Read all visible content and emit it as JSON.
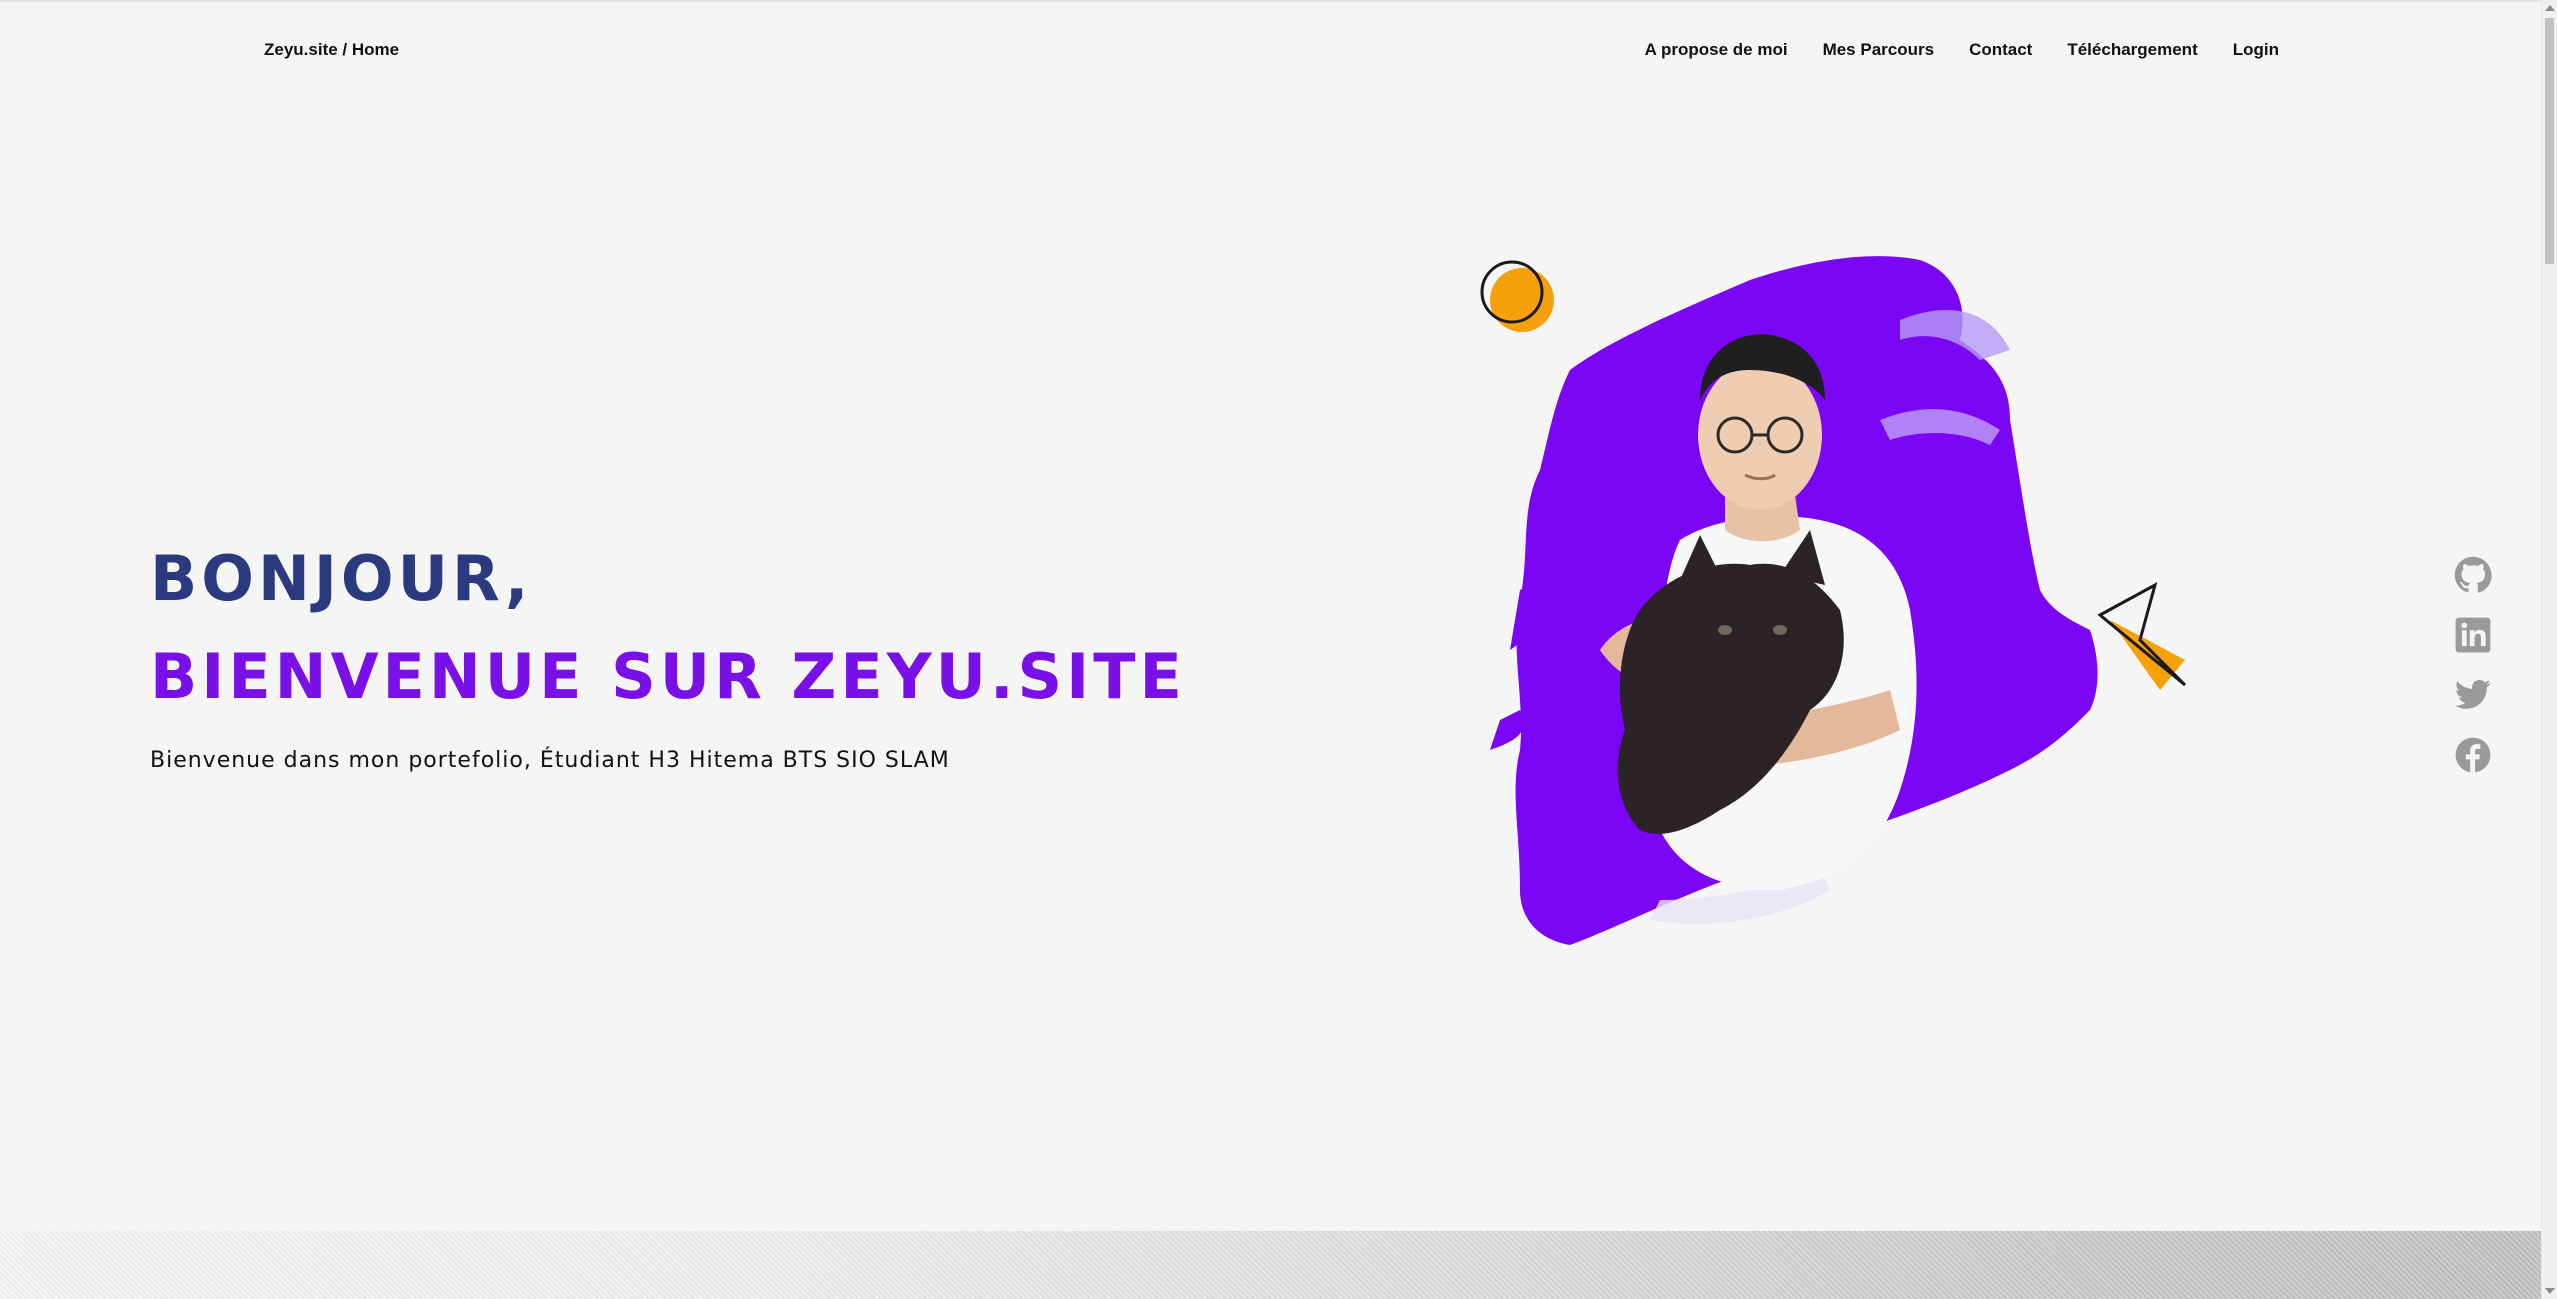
{
  "nav": {
    "brand": "Zeyu.site / Home",
    "links": [
      {
        "label": "A propose de moi"
      },
      {
        "label": "Mes Parcours"
      },
      {
        "label": "Contact"
      },
      {
        "label": "Téléchargement"
      },
      {
        "label": "Login"
      }
    ]
  },
  "hero": {
    "line1": "BONJOUR,",
    "line2": "BIENVENUE SUR ZEYU.SITE",
    "subtitle": "Bienvenue dans mon portefolio, Étudiant H3 Hitema BTS SIO SLAM"
  },
  "social": [
    {
      "icon": "github-icon"
    },
    {
      "icon": "linkedin-icon"
    },
    {
      "icon": "twitter-icon"
    },
    {
      "icon": "facebook-icon"
    }
  ],
  "colors": {
    "title_dark": "#2b3a7e",
    "title_accent": "#7a10e8",
    "brush": "#7a06f5",
    "orange": "#f5a10b",
    "icon_gray": "#9a9a9a",
    "background": "#f5f5f6"
  }
}
